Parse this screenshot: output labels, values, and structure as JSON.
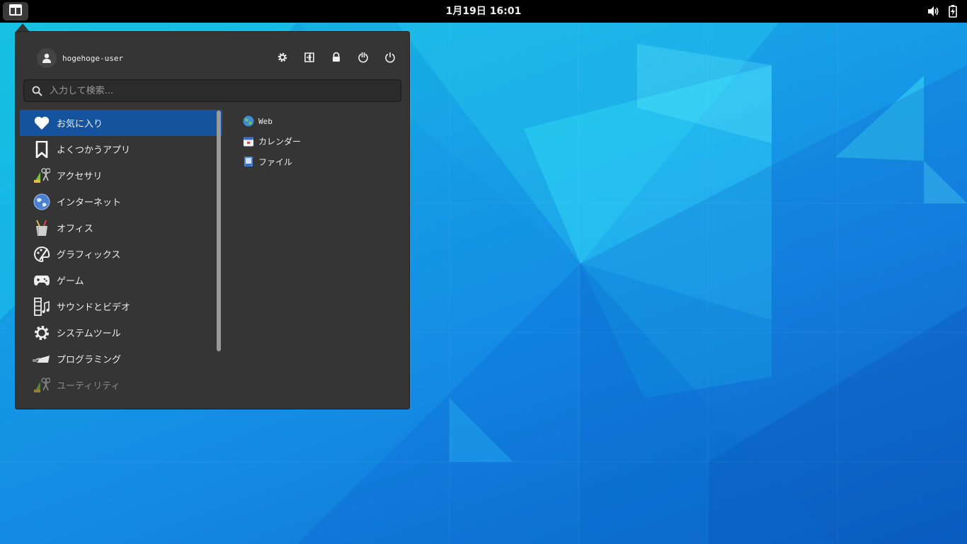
{
  "topbar": {
    "clock": "1月19日  16:01",
    "icons": [
      "applications-menu-icon",
      "volume-icon",
      "battery-charging-icon"
    ]
  },
  "menu": {
    "user": {
      "name": "hogehoge-user",
      "icon": "user-avatar-icon"
    },
    "actions": [
      "settings-icon",
      "logout-icon",
      "lock-icon",
      "restart-icon",
      "power-icon"
    ],
    "search": {
      "placeholder": "入力して検索...",
      "value": ""
    },
    "categories": [
      {
        "label": "お気に入り",
        "icon": "heart-icon",
        "active": true
      },
      {
        "label": "よくつかうアプリ",
        "icon": "bookmark-icon"
      },
      {
        "label": "アクセサリ",
        "icon": "accessories-icon"
      },
      {
        "label": "インターネット",
        "icon": "globe-icon"
      },
      {
        "label": "オフィス",
        "icon": "office-icon"
      },
      {
        "label": "グラフィックス",
        "icon": "palette-icon"
      },
      {
        "label": "ゲーム",
        "icon": "gamepad-icon"
      },
      {
        "label": "サウンドとビデオ",
        "icon": "film-music-icon"
      },
      {
        "label": "システムツール",
        "icon": "gear-icon"
      },
      {
        "label": "プログラミング",
        "icon": "trowel-icon"
      },
      {
        "label": "ユーティリティ",
        "icon": "utilities-icon",
        "faded": true
      }
    ],
    "apps": [
      {
        "label": "Web",
        "icon": "web-browser-icon"
      },
      {
        "label": "カレンダー",
        "icon": "calendar-icon"
      },
      {
        "label": "ファイル",
        "icon": "files-icon"
      }
    ]
  },
  "colors": {
    "panel_bg": "#353535",
    "selected_bg": "#15539e",
    "topbar_bg": "#000000"
  }
}
